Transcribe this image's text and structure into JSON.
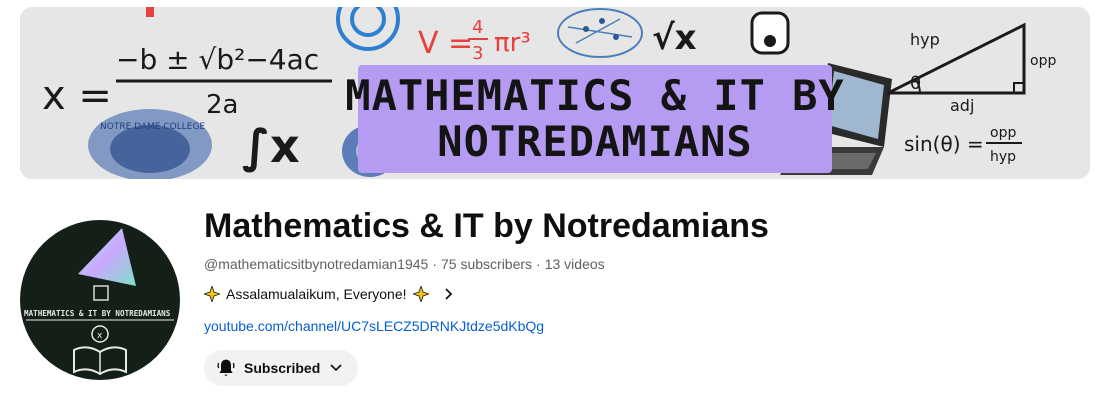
{
  "banner": {
    "title_line1": "MATHEMATICS & IT BY",
    "title_line2": "NOTREDAMIANS",
    "formula_x": "x =",
    "formula_quadratic": "−b ± √b²−4ac",
    "formula_denominator": "2a",
    "formula_volume": "V = ",
    "formula_volume_frac_num": "4",
    "formula_volume_frac_den": "3",
    "formula_volume_rest": "πr³",
    "triangle_hyp": "hyp",
    "triangle_opp": "opp",
    "triangle_adj": "adj",
    "triangle_theta": "θ",
    "sin_formula_left": "sin(θ) =",
    "sin_formula_num": "opp",
    "sin_formula_den": "hyp",
    "college_seal_text": "NOTRE DAME COLLEGE",
    "sqrt_x": "√x",
    "integral_x": "∫x"
  },
  "avatar": {
    "caption": "MATHEMATICS & IT BY NOTREDAMIANS",
    "bulb_x": "x"
  },
  "channel": {
    "title": "Mathematics & IT by Notredamians",
    "handle": "@mathematicsitbynotredamian1945",
    "separator": "·",
    "subscribers": "75 subscribers",
    "videos": "13 videos",
    "description": "Assalamualaikum, Everyone!",
    "link": "youtube.com/channel/UC7sLECZ5DRNKJtdze5dKbQg",
    "subscribe_label": "Subscribed"
  },
  "colors": {
    "banner_bg": "#e6e6e6",
    "title_box": "#b59cf2",
    "link": "#065fd4",
    "button_bg": "#f2f2f2",
    "formula_red": "#e8413c",
    "gear_blue": "#2f7fd1"
  }
}
